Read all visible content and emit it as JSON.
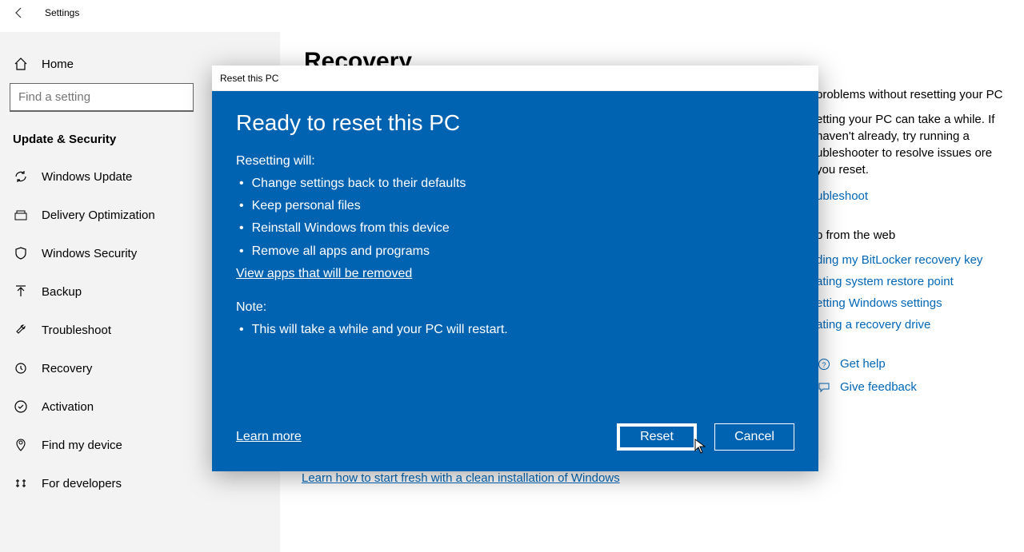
{
  "window": {
    "title": "Settings"
  },
  "sidebar": {
    "home": "Home",
    "search_placeholder": "Find a setting",
    "category": "Update & Security",
    "items": [
      {
        "label": "Windows Update"
      },
      {
        "label": "Delivery Optimization"
      },
      {
        "label": "Windows Security"
      },
      {
        "label": "Backup"
      },
      {
        "label": "Troubleshoot"
      },
      {
        "label": "Recovery"
      },
      {
        "label": "Activation"
      },
      {
        "label": "Find my device"
      },
      {
        "label": "For developers"
      }
    ]
  },
  "main": {
    "title": "Recovery",
    "clean_install_link": "Learn how to start fresh with a clean installation of Windows"
  },
  "right": {
    "fix_heading_part": "problems without resetting your PC",
    "fix_body_part": "etting your PC can take a while. If haven't already, try running a ubleshooter to resolve issues ore you reset.",
    "troubleshoot_link": "ubleshoot",
    "web_heading": "p from the web",
    "web_links": [
      "ding my BitLocker recovery key",
      "ating system restore point",
      "etting Windows settings",
      "ating a recovery drive"
    ],
    "get_help": "Get help",
    "give_feedback": "Give feedback"
  },
  "modal": {
    "window_title": "Reset this PC",
    "title": "Ready to reset this PC",
    "resetting_label": "Resetting will:",
    "bullets": [
      "Change settings back to their defaults",
      "Keep personal files",
      "Reinstall Windows from this device",
      "Remove all apps and programs"
    ],
    "view_apps_link": "View apps that will be removed",
    "note_label": "Note:",
    "note_bullet": "This will take a while and your PC will restart.",
    "learn_more": "Learn more",
    "reset_btn": "Reset",
    "cancel_btn": "Cancel"
  }
}
